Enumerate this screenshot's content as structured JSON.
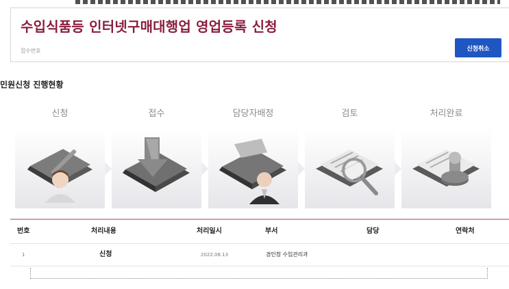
{
  "header": {
    "title": "수입식품등 인터넷구매대행업 영업등록 신청",
    "receipt_label": "접수번호",
    "cancel_label": "신청취소"
  },
  "progress": {
    "title": "민원신청 진행현황",
    "steps": [
      {
        "label": "신청",
        "icon": "folder-pen-person-icon"
      },
      {
        "label": "접수",
        "icon": "folder-arrow-icon"
      },
      {
        "label": "담당자배정",
        "icon": "folder-person-icon"
      },
      {
        "label": "검토",
        "icon": "document-magnifier-icon"
      },
      {
        "label": "처리완료",
        "icon": "document-stamp-icon"
      }
    ]
  },
  "history": {
    "headers": [
      "번호",
      "처리내용",
      "처리일시",
      "부서",
      "담당",
      "연락처"
    ],
    "rows": [
      {
        "num": "1",
        "content": "신청",
        "date": "2022.08.13",
        "dept": "경인청 수입관리과",
        "person": "",
        "contact": ""
      }
    ]
  },
  "colors": {
    "title": "#8a1e3d",
    "button": "#1f56c1",
    "table_top_border": "#cfa0a8"
  }
}
